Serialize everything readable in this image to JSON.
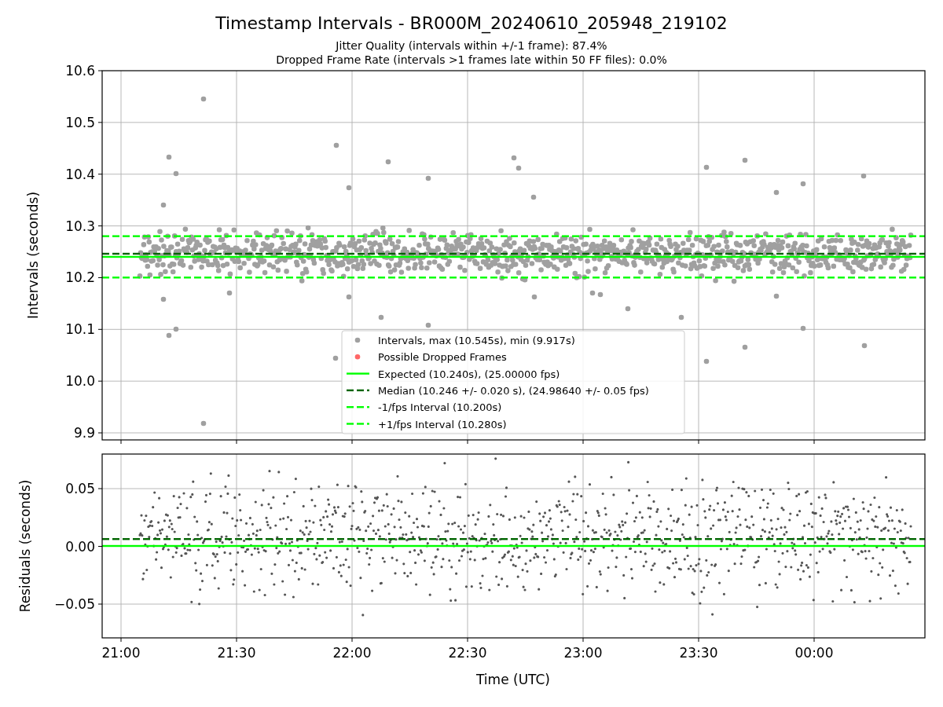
{
  "figure": {
    "title": "Timestamp Intervals - BR000M_20240610_205948_219102",
    "subtitle_lines": [
      "Jitter Quality (intervals within +/-1 frame): 87.4%",
      "Dropped Frame Rate (intervals >1 frames late within 50 FF files): 0.0%"
    ],
    "x_tick_labels": [
      "21:00",
      "21:30",
      "22:00",
      "22:30",
      "23:00",
      "23:30",
      "00:00"
    ],
    "xlabel": "Time (UTC)"
  },
  "panels": [
    {
      "ylabel": "Intervals (seconds)",
      "y_tick_labels": [
        "10.6",
        "10.5",
        "10.4",
        "10.3",
        "10.2",
        "10.1",
        "10.0",
        "9.9"
      ],
      "legend": [
        {
          "label": "Intervals, max (10.545s), min (9.917s)",
          "kind": "point",
          "color": "#a0a0a0"
        },
        {
          "label": "Possible Dropped Frames",
          "kind": "point",
          "color": "#ff6666"
        },
        {
          "label": "Expected (10.240s), (25.00000 fps)",
          "kind": "solid",
          "color": "#00ff00"
        },
        {
          "label": "Median (10.246 +/- 0.020 s), (24.98640 +/- 0.05 fps)",
          "kind": "dashed",
          "color": "#006400"
        },
        {
          "label": "-1/fps Interval (10.200s)",
          "kind": "dashed",
          "color": "#00ff00"
        },
        {
          "label": "+1/fps Interval (10.280s)",
          "kind": "dashed",
          "color": "#00ff00"
        }
      ]
    },
    {
      "ylabel": "Residuals (seconds)",
      "y_tick_labels": [
        "0.05",
        "0.00",
        "−0.05"
      ]
    }
  ]
}
